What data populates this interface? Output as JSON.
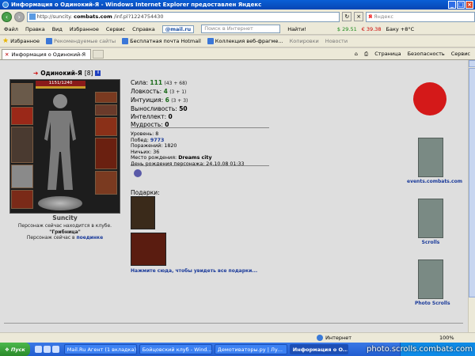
{
  "window": {
    "title": "Информация о Одинокий-Я - Windows Internet Explorer предоставлен Яндекс"
  },
  "address": {
    "prefix": "http://suncity.",
    "host": "combats.com",
    "path": "/inf.pl?1224754430",
    "search_placeholder": "Яндекс"
  },
  "menu": {
    "items": [
      "Файл",
      "Правка",
      "Вид",
      "Избранное",
      "Сервис",
      "Справка"
    ],
    "mailru": "@mail.ru",
    "search_placeholder": "Поиск в Интернет",
    "find": "Найти!",
    "usd": "29.51",
    "eur": "39.38",
    "weather": "Баку +8°C"
  },
  "favorites": {
    "label": "Избранное",
    "items": [
      "Рекомендуемые сайты",
      "Бесплатная почта Hotmail",
      "Коллекция веб-фрагме...",
      "Копировки",
      "Новости"
    ]
  },
  "tab": {
    "label": "Информация о Одинокий-Я",
    "tools": [
      "Страница",
      "Безопасность",
      "Сервис"
    ]
  },
  "character": {
    "name": "Одинокий-Я",
    "level": "[8]",
    "hp": "1151/1240",
    "server_name": "Suncity",
    "club_line1": "Персонаж сейчас находится в клубе.",
    "club_name": "\"Грибница\"",
    "location_prefix": "Персонаж сейчас в",
    "location": "поединке"
  },
  "stats": {
    "strength": {
      "label": "Сила:",
      "value": "111",
      "extra": "(43 + 68)"
    },
    "agility": {
      "label": "Ловкость:",
      "value": "4",
      "extra": "(3 + 1)"
    },
    "intuition": {
      "label": "Интуиция:",
      "value": "6",
      "extra": "(3 + 3)"
    },
    "endurance": {
      "label": "Выносливость:",
      "value": "50"
    },
    "intellect": {
      "label": "Интеллект:",
      "value": "0"
    },
    "wisdom": {
      "label": "Мудрость:",
      "value": "0"
    }
  },
  "info": {
    "level": "Уровень: 8",
    "wins_label": "Побед:",
    "wins": "9773",
    "losses": "Поражений: 1820",
    "draws": "Ничьих: 36",
    "birthplace_label": "Место рождения:",
    "birthplace": "Dreams city",
    "birthday": "День рождения персонажа: 24.10.08 01:33"
  },
  "gifts": {
    "title": "Подарки:",
    "link": "Нажмите сюда, чтобы увидеть все подарки..."
  },
  "sidebar": {
    "events": "events.combats.com",
    "scrolls": "Scrolls",
    "photo": "Photo Scrolls"
  },
  "status": {
    "zone": "Интернет",
    "zoom": "100%"
  },
  "taskbar": {
    "start": "Пуск",
    "tasks": [
      "Mail.Ru Агент (1 вкладка)",
      "Бойцовский клуб - Wind...",
      "Демотиваторы.ру | Лу...",
      "Информация о О..."
    ],
    "watermark": "photo.scrolls.combats.com"
  }
}
